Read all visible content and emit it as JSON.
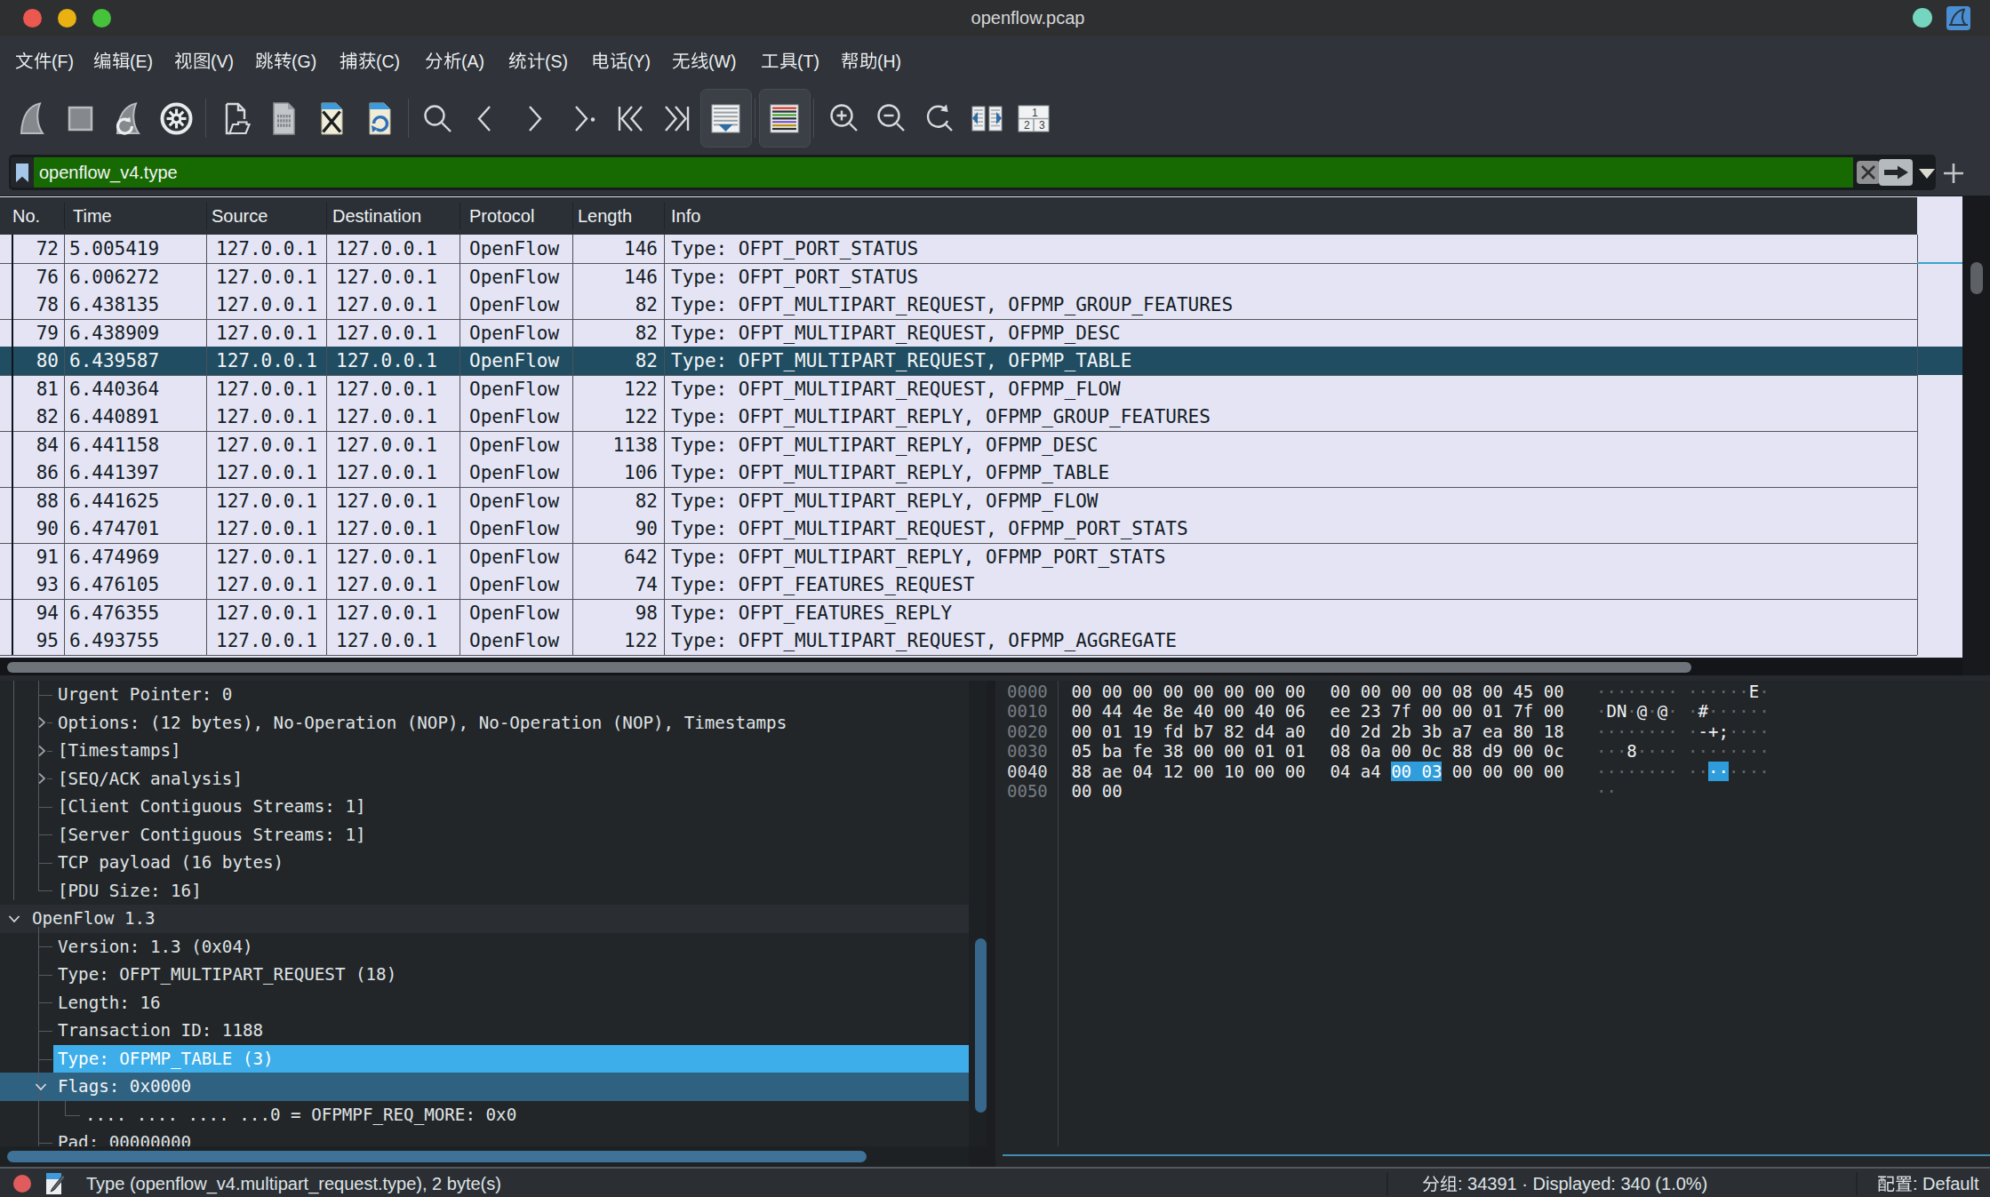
{
  "window": {
    "title": "openflow.pcap",
    "traffic_lights": [
      "close",
      "minimize",
      "maximize"
    ],
    "colors": {
      "close": "#ea5850",
      "minimize": "#e9b112",
      "maximize": "#45c33b",
      "capture_status_dot": "#74d6bf",
      "app_icon_bg": "#4a8fd3"
    }
  },
  "menu": {
    "items": [
      {
        "label": "文件(F)",
        "cjk": "文件",
        "ascii": "(F)"
      },
      {
        "label": "编辑(E)",
        "cjk": "编辑",
        "ascii": "(E)"
      },
      {
        "label": "视图(V)",
        "cjk": "视图",
        "ascii": "(V)"
      },
      {
        "label": "跳转(G)",
        "cjk": "跳转",
        "ascii": "(G)"
      },
      {
        "label": "捕获(C)",
        "cjk": "捕获",
        "ascii": "(C)"
      },
      {
        "label": "分析(A)",
        "cjk": "分析",
        "ascii": "(A)"
      },
      {
        "label": "统计(S)",
        "cjk": "统计",
        "ascii": "(S)"
      },
      {
        "label": "电话(Y)",
        "cjk": "电话",
        "ascii": "(Y)"
      },
      {
        "label": "无线(W)",
        "cjk": "无线",
        "ascii": "(W)"
      },
      {
        "label": "工具(T)",
        "cjk": "工具",
        "ascii": "(T)"
      },
      {
        "label": "帮助(H)",
        "cjk": "帮助",
        "ascii": "(H)"
      }
    ]
  },
  "toolbar": {
    "buttons": [
      "start-capture",
      "stop-capture",
      "restart-capture",
      "capture-options",
      "open-file",
      "save-file",
      "close-file",
      "reload-file",
      "find-packet",
      "previous-packet",
      "next-packet",
      "go-to-packet",
      "first-packet",
      "last-packet",
      "auto-scroll",
      "colorize",
      "zoom-in",
      "zoom-out",
      "zoom-reset",
      "resize-columns",
      "layout-123"
    ],
    "active_toggles": [
      "auto-scroll",
      "colorize"
    ]
  },
  "filter": {
    "value": "openflow_v4.type",
    "status_color": "#176a02"
  },
  "packet_list": {
    "columns": [
      "No.",
      "Time",
      "Source",
      "Destination",
      "Protocol",
      "Length",
      "Info"
    ],
    "rows": [
      {
        "no": "72",
        "time": "5.005419",
        "src": "127.0.0.1",
        "dst": "127.0.0.1",
        "proto": "OpenFlow",
        "len": "146",
        "info": "Type: OFPT_PORT_STATUS"
      },
      {
        "no": "76",
        "time": "6.006272",
        "src": "127.0.0.1",
        "dst": "127.0.0.1",
        "proto": "OpenFlow",
        "len": "146",
        "info": "Type: OFPT_PORT_STATUS",
        "sep": true
      },
      {
        "no": "78",
        "time": "6.438135",
        "src": "127.0.0.1",
        "dst": "127.0.0.1",
        "proto": "OpenFlow",
        "len": "82",
        "info": "Type: OFPT_MULTIPART_REQUEST, OFPMP_GROUP_FEATURES"
      },
      {
        "no": "79",
        "time": "6.438909",
        "src": "127.0.0.1",
        "dst": "127.0.0.1",
        "proto": "OpenFlow",
        "len": "82",
        "info": "Type: OFPT_MULTIPART_REQUEST, OFPMP_DESC",
        "sep": true
      },
      {
        "no": "80",
        "time": "6.439587",
        "src": "127.0.0.1",
        "dst": "127.0.0.1",
        "proto": "OpenFlow",
        "len": "82",
        "info": "Type: OFPT_MULTIPART_REQUEST, OFPMP_TABLE",
        "selected": true
      },
      {
        "no": "81",
        "time": "6.440364",
        "src": "127.0.0.1",
        "dst": "127.0.0.1",
        "proto": "OpenFlow",
        "len": "122",
        "info": "Type: OFPT_MULTIPART_REQUEST, OFPMP_FLOW",
        "sep": true
      },
      {
        "no": "82",
        "time": "6.440891",
        "src": "127.0.0.1",
        "dst": "127.0.0.1",
        "proto": "OpenFlow",
        "len": "122",
        "info": "Type: OFPT_MULTIPART_REPLY, OFPMP_GROUP_FEATURES"
      },
      {
        "no": "84",
        "time": "6.441158",
        "src": "127.0.0.1",
        "dst": "127.0.0.1",
        "proto": "OpenFlow",
        "len": "1138",
        "info": "Type: OFPT_MULTIPART_REPLY, OFPMP_DESC",
        "sep": true
      },
      {
        "no": "86",
        "time": "6.441397",
        "src": "127.0.0.1",
        "dst": "127.0.0.1",
        "proto": "OpenFlow",
        "len": "106",
        "info": "Type: OFPT_MULTIPART_REPLY, OFPMP_TABLE"
      },
      {
        "no": "88",
        "time": "6.441625",
        "src": "127.0.0.1",
        "dst": "127.0.0.1",
        "proto": "OpenFlow",
        "len": "82",
        "info": "Type: OFPT_MULTIPART_REPLY, OFPMP_FLOW",
        "sep": true
      },
      {
        "no": "90",
        "time": "6.474701",
        "src": "127.0.0.1",
        "dst": "127.0.0.1",
        "proto": "OpenFlow",
        "len": "90",
        "info": "Type: OFPT_MULTIPART_REQUEST, OFPMP_PORT_STATS"
      },
      {
        "no": "91",
        "time": "6.474969",
        "src": "127.0.0.1",
        "dst": "127.0.0.1",
        "proto": "OpenFlow",
        "len": "642",
        "info": "Type: OFPT_MULTIPART_REPLY, OFPMP_PORT_STATS",
        "sep": true
      },
      {
        "no": "93",
        "time": "6.476105",
        "src": "127.0.0.1",
        "dst": "127.0.0.1",
        "proto": "OpenFlow",
        "len": "74",
        "info": "Type: OFPT_FEATURES_REQUEST"
      },
      {
        "no": "94",
        "time": "6.476355",
        "src": "127.0.0.1",
        "dst": "127.0.0.1",
        "proto": "OpenFlow",
        "len": "98",
        "info": "Type: OFPT_FEATURES_REPLY",
        "sep": true
      },
      {
        "no": "95",
        "time": "6.493755",
        "src": "127.0.0.1",
        "dst": "127.0.0.1",
        "proto": "OpenFlow",
        "len": "122",
        "info": "Type: OFPT_MULTIPART_REQUEST, OFPMP_AGGREGATE"
      }
    ]
  },
  "detail": {
    "rows": [
      {
        "text": "Urgent Pointer: 0",
        "depth": 1,
        "tick": true
      },
      {
        "text": "Options: (12 bytes), No-Operation (NOP), No-Operation (NOP), Timestamps",
        "depth": 1,
        "chevron": "collapsed"
      },
      {
        "text": "[Timestamps]",
        "depth": 1,
        "chevron": "collapsed"
      },
      {
        "text": "[SEQ/ACK analysis]",
        "depth": 1,
        "chevron": "collapsed"
      },
      {
        "text": "[Client Contiguous Streams: 1]",
        "depth": 1,
        "tick": true
      },
      {
        "text": "[Server Contiguous Streams: 1]",
        "depth": 1,
        "tick": true
      },
      {
        "text": "TCP payload (16 bytes)",
        "depth": 1,
        "tick": true
      },
      {
        "text": "[PDU Size: 16]",
        "depth": 1,
        "tick": true
      },
      {
        "text": "OpenFlow 1.3",
        "depth": 0,
        "chevron": "expanded",
        "band": true
      },
      {
        "text": "Version: 1.3 (0x04)",
        "depth": 1,
        "tick": true
      },
      {
        "text": "Type: OFPT_MULTIPART_REQUEST (18)",
        "depth": 1,
        "tick": true
      },
      {
        "text": "Length: 16",
        "depth": 1,
        "tick": true
      },
      {
        "text": "Transaction ID: 1188",
        "depth": 1,
        "tick": true
      },
      {
        "text": "Type: OFPMP_TABLE (3)",
        "depth": 1,
        "tick": true,
        "selected": "bright"
      },
      {
        "text": "Flags: 0x0000",
        "depth": 1,
        "chevron": "expanded",
        "selected": "muted"
      },
      {
        "text": ".... .... .... ...0 = OFPMPF_REQ_MORE: 0x0",
        "depth": 2,
        "corner": true
      },
      {
        "text": "Pad: 00000000",
        "depth": 1,
        "tick": true
      }
    ]
  },
  "hex": {
    "rows": [
      {
        "offset": "0000",
        "g1": "00 00 00 00 00 00 00 00",
        "g2": "00 00 00 00 08 00 45 00",
        "ascii": "········ ······E·"
      },
      {
        "offset": "0010",
        "g1": "00 44 4e 8e 40 00 40 06",
        "g2": "ee 23 7f 00 00 01 7f 00",
        "ascii": "·DN·@·@· ·#······"
      },
      {
        "offset": "0020",
        "g1": "00 01 19 fd b7 82 d4 a0",
        "g2": "d0 2d 2b 3b a7 ea 80 18",
        "ascii": "········ ·-+;····"
      },
      {
        "offset": "0030",
        "g1": "05 ba fe 38 00 00 01 01",
        "g2": "08 0a 00 0c 88 d9 00 0c",
        "ascii": "···8···· ········"
      },
      {
        "offset": "0040",
        "g1": "88 ae 04 12 00 10 00 00",
        "g2pre": "04 a4 ",
        "hl": "00 03",
        "g2post": " 00 00 00 00",
        "ascii_pre": "········ ··",
        "ascii_hl": "··",
        "ascii_post": "····",
        "offset_bright": true
      },
      {
        "offset": "0050",
        "g1": "00 00",
        "g2": "",
        "ascii": "··"
      }
    ]
  },
  "status": {
    "field_info": "Type (openflow_v4.multipart_request.type), 2 byte(s)",
    "packets_label": "分组",
    "packets_cjk": "分组",
    "packets_rest": ": 34391 · Displayed: 340 (1.0%)",
    "packets_full": "分组: 34391 · Displayed: 340 (1.0%)",
    "profile_label": "配置",
    "profile_cjk": "配置",
    "profile_rest": ":  Default",
    "profile_full": "配置: Default"
  }
}
